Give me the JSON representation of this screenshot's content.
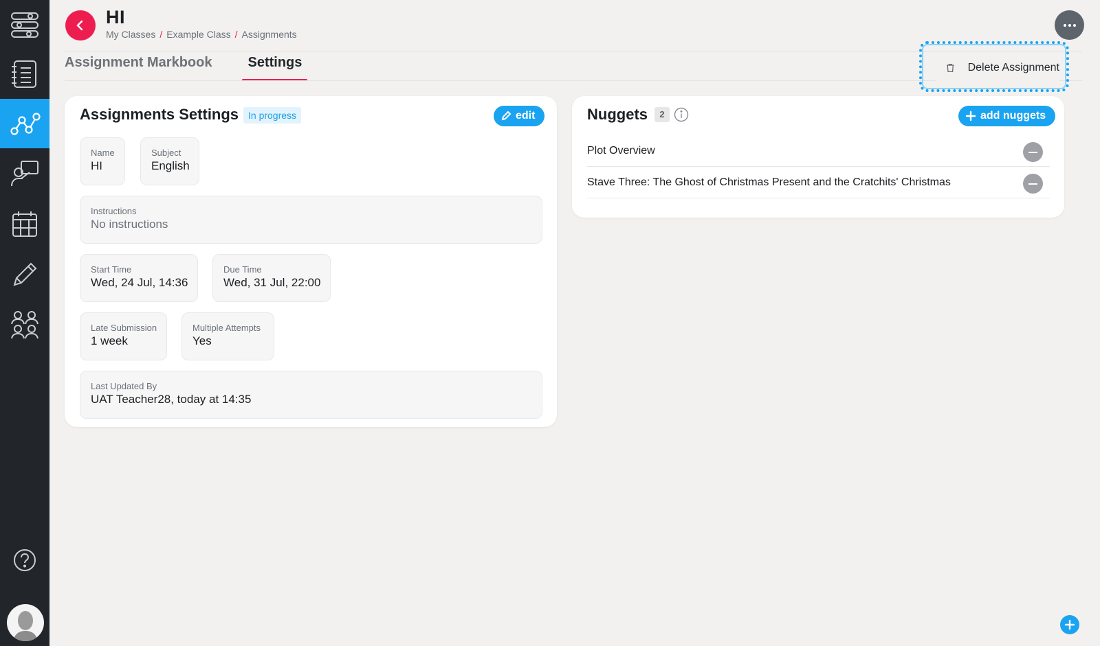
{
  "header": {
    "title": "HI",
    "breadcrumb": [
      "My Classes",
      "Example Class",
      "Assignments"
    ],
    "breadcrumb_separator": "/"
  },
  "tabs": [
    {
      "label": "Assignment Markbook",
      "active": false
    },
    {
      "label": "Settings",
      "active": true
    }
  ],
  "menu": {
    "delete_label": "Delete Assignment"
  },
  "settings": {
    "title": "Assignments Settings",
    "status": "In progress",
    "edit_label": "edit",
    "name": {
      "label": "Name",
      "value": "HI"
    },
    "subject": {
      "label": "Subject",
      "value": "English"
    },
    "instructions": {
      "label": "Instructions",
      "value": "No instructions"
    },
    "start_time": {
      "label": "Start Time",
      "value": "Wed, 24 Jul, 14:36"
    },
    "due_time": {
      "label": "Due Time",
      "value": "Wed, 31 Jul, 22:00"
    },
    "late_submission": {
      "label": "Late Submission",
      "value": "1 week"
    },
    "multiple_attempts": {
      "label": "Multiple Attempts",
      "value": "Yes"
    },
    "last_updated": {
      "label": "Last Updated By",
      "value": "UAT Teacher28, today at 14:35"
    }
  },
  "nuggets": {
    "title": "Nuggets",
    "count": "2",
    "add_label": "add nuggets",
    "items": [
      {
        "label": "Plot Overview"
      },
      {
        "label": "Stave Three: The Ghost of Christmas Present and the Cratchits' Christmas"
      }
    ]
  },
  "sidebar": {
    "active_index": 2,
    "items": [
      "dashboard-icon",
      "notebook-icon",
      "analytics-icon",
      "teacher-icon",
      "calendar-icon",
      "pencil-icon",
      "people-icon"
    ]
  },
  "colors": {
    "accent_blue": "#1aa3f0",
    "accent_red": "#ed1e4f",
    "sidebar_bg": "#22262b",
    "page_bg": "#f2f1ef"
  }
}
